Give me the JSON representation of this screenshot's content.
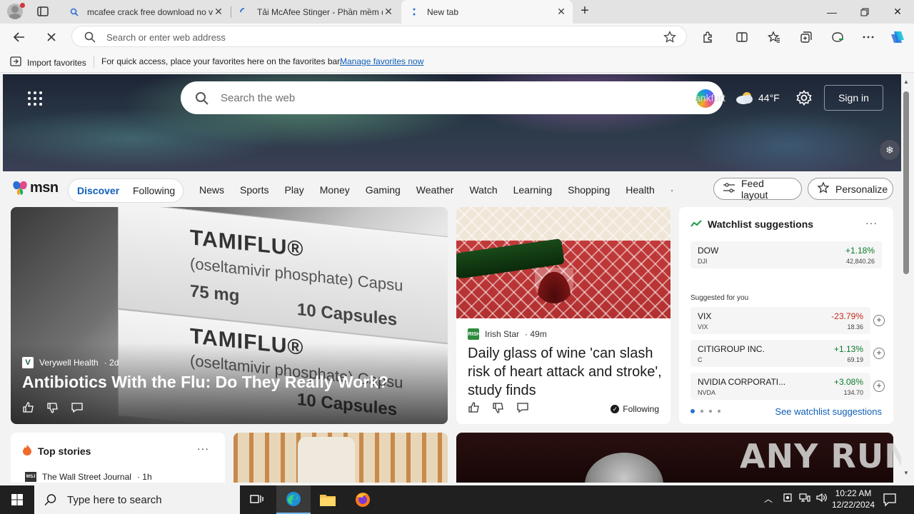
{
  "browser": {
    "tabs": [
      {
        "label": "mcafee crack free download no v",
        "active": false
      },
      {
        "label": "Tải McAfee Stinger - Phần mềm d",
        "active": false
      },
      {
        "label": "New tab",
        "active": true
      }
    ],
    "address_placeholder": "Search or enter web address",
    "favorites_bar": {
      "import_label": "Import favorites",
      "message": "For quick access, place your favorites here on the favorites bar.",
      "manage_link": "Manage favorites now"
    }
  },
  "msn": {
    "search_placeholder": "Search the web",
    "location": "ankfurt",
    "temperature": "44°F",
    "sign_in": "Sign in",
    "logo_text": "msn",
    "discover": "Discover",
    "following": "Following",
    "categories": [
      "News",
      "Sports",
      "Play",
      "Money",
      "Gaming",
      "Weather",
      "Watch",
      "Learning",
      "Shopping",
      "Health"
    ],
    "feed_layout": "Feed layout",
    "personalize": "Personalize",
    "main_story": {
      "source": "Verywell Health",
      "age": "· 2d",
      "headline": "Antibiotics With the Flu: Do They Really Work?",
      "box_text": {
        "brand": "TAMIFLU®",
        "generic": "(oseltamivir phosphate) Capsu",
        "dose": "75 mg",
        "count": "10 Capsules"
      }
    },
    "wine_story": {
      "source": "Irish Star",
      "age": "· 49m",
      "headline": "Daily glass of wine 'can slash risk of heart attack and stroke', study finds",
      "following": "Following"
    },
    "watchlist": {
      "title": "Watchlist suggestions",
      "main": {
        "name": "DOW",
        "ticker": "DJI",
        "change": "+1.18%",
        "price": "42,840.26"
      },
      "suggested_label": "Suggested for you",
      "items": [
        {
          "name": "VIX",
          "ticker": "VIX",
          "change": "-23.79%",
          "price": "18.36",
          "direction": "down"
        },
        {
          "name": "CITIGROUP INC.",
          "ticker": "C",
          "change": "+1.13%",
          "price": "69.19",
          "direction": "up"
        },
        {
          "name": "NVIDIA CORPORATI...",
          "ticker": "NVDA",
          "change": "+3.08%",
          "price": "134.70",
          "direction": "up"
        }
      ],
      "see_link": "See watchlist suggestions"
    },
    "top_stories": {
      "title": "Top stories",
      "first_source": "The Wall Street Journal",
      "first_age": "· 1h"
    }
  },
  "watermark": "ANY RUN",
  "taskbar": {
    "search_placeholder": "Type here to search",
    "time": "10:22 AM",
    "date": "12/22/2024"
  },
  "colors": {
    "accent": "#0f5fb8",
    "up": "#0b7a2a",
    "down": "#c42b1c",
    "taskbar": "#202020"
  }
}
